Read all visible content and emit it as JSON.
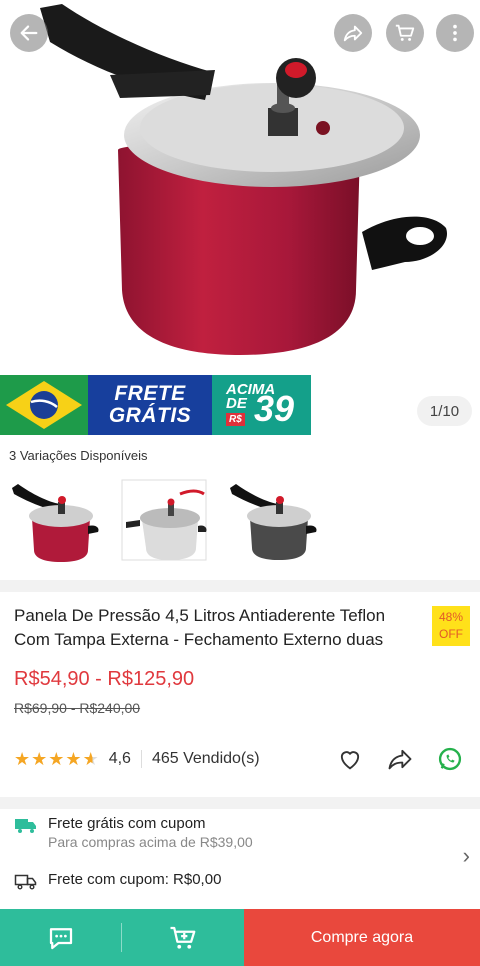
{
  "header": {
    "back_icon": "arrow-left-icon",
    "share_icon": "share-icon",
    "cart_icon": "cart-icon",
    "more_icon": "more-vertical-icon"
  },
  "gallery": {
    "counter": "1/10",
    "promo": {
      "frete_line1": "FRETE",
      "frete_line2": "GRÁTIS",
      "acima_line1": "ACIMA",
      "acima_line2": "DE",
      "currency": "R$",
      "amount": "39"
    }
  },
  "variations": {
    "label": "3 Variações Disponíveis",
    "items": [
      "red",
      "silver",
      "gray"
    ]
  },
  "product": {
    "title": "Panela De Pressão 4,5 Litros Antiaderente Teflon Com Tampa Externa - Fechamento Externo duas",
    "discount_percent": "48%",
    "discount_label": "OFF",
    "price_range": "R$54,90 - R$125,90",
    "old_price_range": "R$69,90 - R$240,00",
    "rating": "4,6",
    "rating_value": 4.6,
    "sold": "465 Vendido(s)"
  },
  "shipping": {
    "line1_title": "Frete grátis com cupom",
    "line1_subtitle": "Para compras acima de R$39,00",
    "line2": "Frete com cupom: R$0,00"
  },
  "bottom_bar": {
    "chat_icon": "chat-icon",
    "add_cart_icon": "add-to-cart-icon",
    "buy_label": "Compre agora"
  },
  "colors": {
    "accent_green": "#2ebd9b",
    "buy_red": "#e9483d",
    "price_red": "#e0393e",
    "star": "#f5a623"
  }
}
